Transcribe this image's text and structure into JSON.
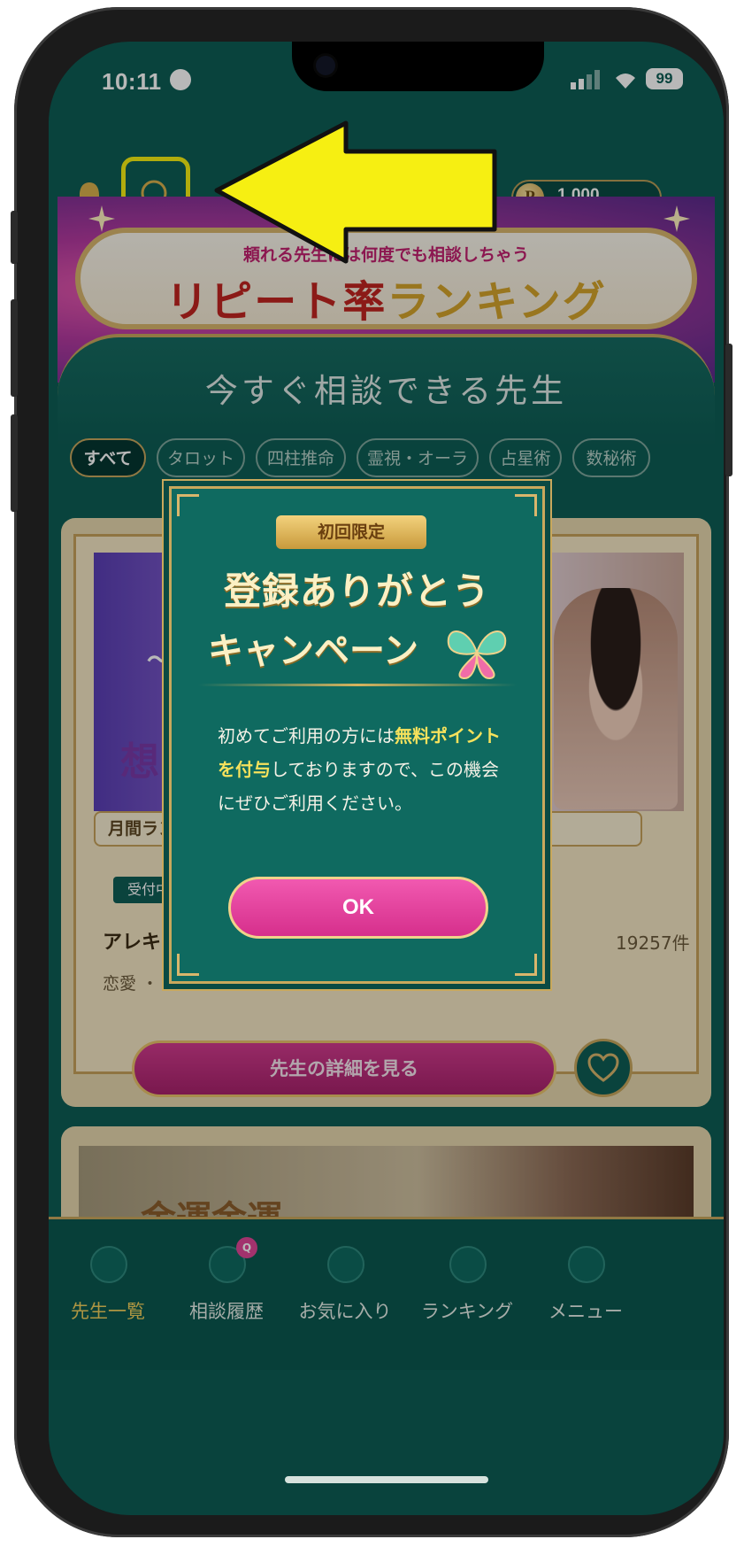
{
  "status_bar": {
    "time": "10:11",
    "battery": "99"
  },
  "header": {
    "points": "1,000",
    "coin_symbol": "P"
  },
  "banner": {
    "subtitle": "頼れる先生には何度でも相談しちゃう",
    "title_red": "リピート率",
    "title_gold": "ランキング"
  },
  "section": {
    "title": "今すぐ相談できる先生"
  },
  "filters": [
    {
      "label": "すべて",
      "active": true
    },
    {
      "label": "タロット",
      "active": false
    },
    {
      "label": "四柱推命",
      "active": false
    },
    {
      "label": "霊視・オーラ",
      "active": false
    },
    {
      "label": "占星術",
      "active": false
    },
    {
      "label": "数秘術",
      "active": false
    }
  ],
  "card": {
    "image_text_small": "～",
    "image_text": "想い",
    "monthly_label": "月間ラン",
    "status_badge": "受付中",
    "name": "アレキ",
    "count": "19257件",
    "genre": "恋愛 ・",
    "detail_button": "先生の詳細を見る"
  },
  "card2": {
    "image_text": "金運金運"
  },
  "modal": {
    "ribbon": "初回限定",
    "title_line1": "登録ありがとう",
    "title_line2": "キャンペーン",
    "body_pre": "初めてご利用の方には",
    "body_bold": "無料ポイントを付与",
    "body_post": "しておりますので、この機会にぜひご利用ください。",
    "ok_label": "OK"
  },
  "tabbar": [
    {
      "label": "先生一覧",
      "icon": "compass-icon",
      "active": true
    },
    {
      "label": "相談履歴",
      "icon": "chat-icon",
      "active": false,
      "badge": "Q"
    },
    {
      "label": "お気に入り",
      "icon": "heart-icon",
      "active": false
    },
    {
      "label": "ランキング",
      "icon": "crown-icon",
      "active": false
    },
    {
      "label": "メニュー",
      "icon": "warning-icon",
      "active": false
    }
  ],
  "colors": {
    "accent_yellow": "#f6ef12",
    "teal": "#0d5e55",
    "gold": "#c8a75e",
    "pink": "#d62f8c"
  }
}
